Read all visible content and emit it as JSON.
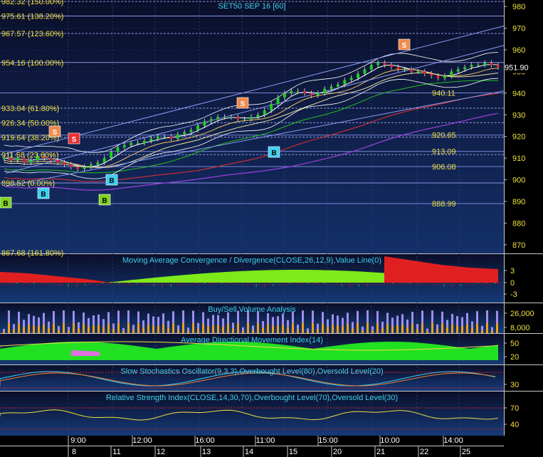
{
  "main": {
    "title": "SET50 SEP 16  [60]",
    "last_price": "951.90",
    "yticks": [
      "980",
      "970",
      "960",
      "950",
      "940",
      "930",
      "920",
      "910",
      "900",
      "890",
      "880",
      "870"
    ],
    "fib_levels": [
      {
        "label": "982.32 (150.00%)",
        "value": 982.32
      },
      {
        "label": "975.61 (138.20%)",
        "value": 975.61
      },
      {
        "label": "967.57 (123.60%)",
        "value": 967.57
      },
      {
        "label": "954.16 (100.00%)",
        "value": 954.16
      },
      {
        "label": "933.04 (61.80%)",
        "value": 933.04
      },
      {
        "label": "926.34 (50.00%)",
        "value": 926.34
      },
      {
        "label": "919.64 (38.20%)",
        "value": 919.64
      },
      {
        "label": "911.58 (23.60%)",
        "value": 911.58
      },
      {
        "label": "898.52 (0.00%)",
        "value": 898.52
      }
    ],
    "right_labels": [
      {
        "label": "940.11",
        "value": 940.11
      },
      {
        "label": "920.65",
        "value": 920.65
      },
      {
        "label": "913.09",
        "value": 913.09
      },
      {
        "label": "906.08",
        "value": 906.08
      },
      {
        "label": "888.99",
        "value": 888.99
      }
    ],
    "bottom_left_label": "867.68 (161.80%)",
    "signals": [
      {
        "text": "B",
        "color": "#7ed321"
      },
      {
        "text": "B",
        "color": "#3fd0f0"
      },
      {
        "text": "S",
        "color": "#e83030"
      },
      {
        "text": "S",
        "color": "#f08a4b"
      },
      {
        "text": "B",
        "color": "#3fd0f0"
      },
      {
        "text": "B",
        "color": "#7ed321"
      },
      {
        "text": "S",
        "color": "#f08a4b"
      },
      {
        "text": "B",
        "color": "#3fd0f0"
      },
      {
        "text": "S",
        "color": "#f08a4b"
      }
    ]
  },
  "panels": {
    "macd": {
      "title": "Moving Average Convergence / Divergence(CLOSE,26,12,9),Value Line(0)",
      "ticks": [
        "3",
        "0",
        "-3"
      ]
    },
    "volume": {
      "title": "Buy/Sell Volume Analysis",
      "ticks": [
        "26,000",
        "8,000"
      ]
    },
    "adx": {
      "title": "Average Directional Movement Index(14)",
      "ticks": [
        "50",
        "20"
      ]
    },
    "stoch": {
      "title": "Slow Stochastics Oscillator(9,3,3),Overbought Level(80),Oversold Level(20)",
      "ticks": [
        "30"
      ]
    },
    "rsi": {
      "title": "Relative Strength Index(CLOSE,14,30,70),Overbought Level(70),Oversold Level(30)",
      "ticks": [
        "70",
        "40"
      ]
    }
  },
  "xaxis": {
    "times": [
      "9:00",
      "12:00",
      "16:00",
      "11:00",
      "15:00",
      "10:00",
      "14:00"
    ],
    "dates": [
      "8",
      "11",
      "12",
      "13",
      "14",
      "15",
      "20",
      "21",
      "22",
      "25"
    ]
  },
  "colors": {
    "up": "#22cc22",
    "down": "#e02020",
    "grid": "#6a78c8",
    "label": "#f0e040",
    "cyan": "#3fd0f0"
  },
  "chart_data": {
    "type": "line",
    "title": "SET50 SEP 16  [60]",
    "y_axis": {
      "ticks": [
        980,
        970,
        960,
        950,
        940,
        930,
        920,
        910,
        900,
        890,
        880,
        870
      ],
      "ylim": [
        866,
        983
      ]
    },
    "x_axis_labels": {
      "times": [
        "9:00",
        "12:00",
        "16:00",
        "11:00",
        "15:00",
        "10:00",
        "14:00"
      ],
      "dates": [
        "8",
        "11",
        "12",
        "13",
        "14",
        "15",
        "20",
        "21",
        "22",
        "25"
      ]
    },
    "series": [
      {
        "values": [
          910,
          909,
          910,
          908,
          909,
          911,
          910,
          909,
          908,
          907,
          906,
          905,
          906,
          907,
          908,
          910,
          913,
          915,
          916,
          917,
          917,
          918,
          919,
          920,
          920,
          919,
          921,
          922,
          923,
          925,
          927,
          928,
          929,
          929,
          929,
          928,
          928,
          929,
          930,
          932,
          935,
          938,
          940,
          941,
          941,
          940,
          939,
          940,
          942,
          943,
          944,
          946,
          947,
          949,
          951,
          953,
          954,
          953,
          952,
          951,
          951,
          950,
          950,
          949,
          948,
          947,
          948,
          950,
          951,
          952,
          953,
          953,
          954,
          953,
          952
        ]
      }
    ],
    "horizontal_levels": [
      982.32,
      975.61,
      967.57,
      954.16,
      933.04,
      926.34,
      919.64,
      911.58,
      898.52,
      888.99,
      906.08,
      913.09,
      920.65,
      940.11
    ],
    "last_value": 951.9
  }
}
